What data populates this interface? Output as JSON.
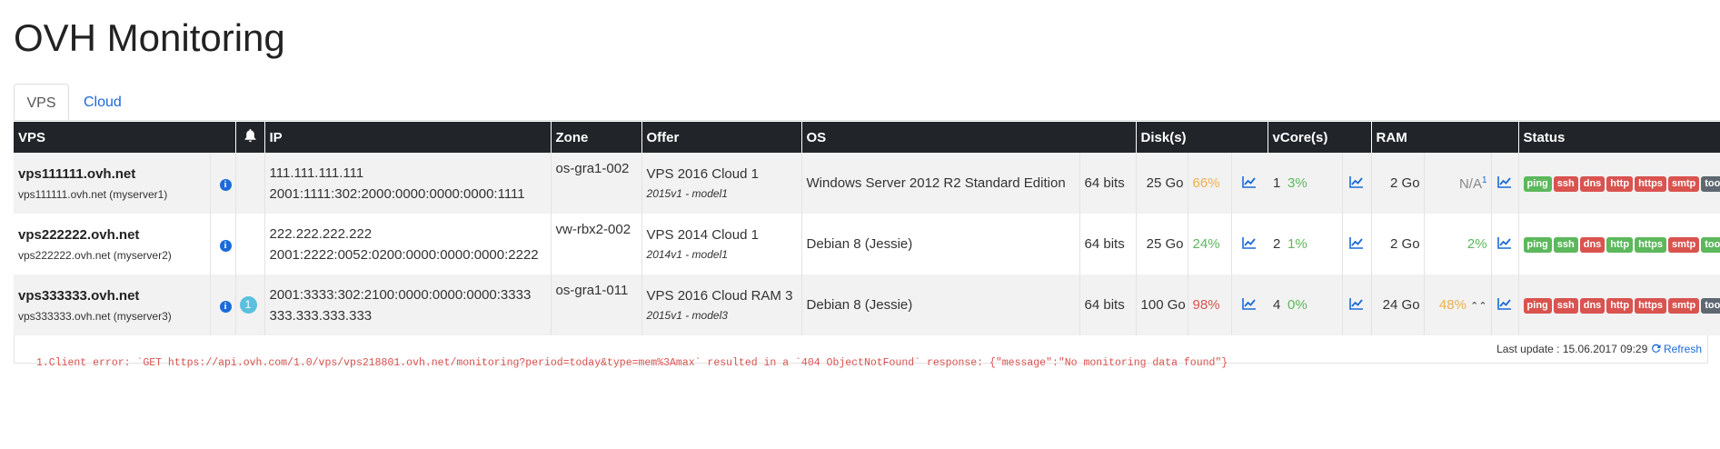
{
  "title": "OVH Monitoring",
  "tabs": [
    {
      "label": "VPS"
    },
    {
      "label": "Cloud"
    }
  ],
  "headers": {
    "vps": "VPS",
    "bell": "🔔",
    "ip": "IP",
    "zone": "Zone",
    "offer": "Offer",
    "os": "OS",
    "disks": "Disk(s)",
    "vcores": "vCore(s)",
    "ram": "RAM",
    "status": "Status"
  },
  "rows": [
    {
      "name": "vps111111.ovh.net",
      "sub": "vps111111.ovh.net (myserver1)",
      "alerts": "",
      "ip1": "111.111.111.111",
      "ip2": "2001:1111:302:2000:0000:0000:0000:1111",
      "zone": "os-gra1-002",
      "offer": "VPS 2016 Cloud 1",
      "model": "2015v1 - model1",
      "os": "Windows Server 2012 R2 Standard Edition",
      "bits": "64 bits",
      "disk": "25 Go",
      "disk_pct": "66%",
      "vcore": "1",
      "vcore_pct": "3%",
      "ram": "2 Go",
      "ram_pct": "N/A",
      "ram_note": "1",
      "ram_arrow": "",
      "status": [
        [
          "ping",
          "g"
        ],
        [
          "ssh",
          "r"
        ],
        [
          "dns",
          "r"
        ],
        [
          "http",
          "r"
        ],
        [
          "https",
          "r"
        ],
        [
          "smtp",
          "r"
        ],
        [
          "tools",
          "gr"
        ]
      ]
    },
    {
      "name": "vps222222.ovh.net",
      "sub": "vps222222.ovh.net (myserver2)",
      "alerts": "",
      "ip1": "222.222.222.222",
      "ip2": "2001:2222:0052:0200:0000:0000:0000:2222",
      "zone": "vw-rbx2-002",
      "offer": "VPS 2014 Cloud 1",
      "model": "2014v1 - model1",
      "os": "Debian 8 (Jessie)",
      "bits": "64 bits",
      "disk": "25 Go",
      "disk_pct": "24%",
      "vcore": "2",
      "vcore_pct": "1%",
      "ram": "2 Go",
      "ram_pct": "2%",
      "ram_note": "",
      "ram_arrow": "",
      "status": [
        [
          "ping",
          "g"
        ],
        [
          "ssh",
          "g"
        ],
        [
          "dns",
          "r"
        ],
        [
          "http",
          "g"
        ],
        [
          "https",
          "g"
        ],
        [
          "smtp",
          "r"
        ],
        [
          "tools",
          "g"
        ]
      ]
    },
    {
      "name": "vps333333.ovh.net",
      "sub": "vps333333.ovh.net (myserver3)",
      "alerts": "1",
      "ip1": "2001:3333:302:2100:0000:0000:0000:3333",
      "ip2": "333.333.333.333",
      "zone": "os-gra1-011",
      "offer": "VPS 2016 Cloud RAM 3",
      "model": "2015v1 - model3",
      "os": "Debian 8 (Jessie)",
      "bits": "64 bits",
      "disk": "100 Go",
      "disk_pct": "98%",
      "vcore": "4",
      "vcore_pct": "0%",
      "ram": "24 Go",
      "ram_pct": "48%",
      "ram_note": "",
      "ram_arrow": "⌃⌃",
      "status": [
        [
          "ping",
          "r"
        ],
        [
          "ssh",
          "r"
        ],
        [
          "dns",
          "r"
        ],
        [
          "http",
          "r"
        ],
        [
          "https",
          "r"
        ],
        [
          "smtp",
          "r"
        ],
        [
          "tools",
          "gr"
        ]
      ]
    }
  ],
  "pct_colors": {
    "66%": "o",
    "3%": "g",
    "24%": "g",
    "1%": "g",
    "2%": "g",
    "98%": "r",
    "0%": "g",
    "48%": "o",
    "N/A": "mut"
  },
  "footer": {
    "last_update": "Last update : 15.06.2017 09:29",
    "refresh": "Refresh"
  },
  "error": "1.Client error: `GET https://api.ovh.com/1.0/vps/vps218801.ovh.net/monitoring?period=today&type=mem%3Amax` resulted in a `404 ObjectNotFound` response: {\"message\":\"No monitoring data found\"}",
  "colors": {
    "header_bg": "#212529",
    "link": "#1b6ad8",
    "green": "#5cb85c",
    "red": "#d9534f",
    "orange": "#f0ad4e",
    "gray": "#5f6871",
    "info": "#5bc0de"
  }
}
